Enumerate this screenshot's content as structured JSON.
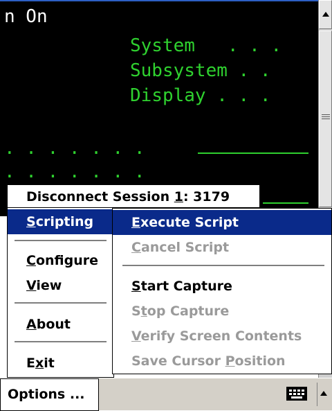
{
  "terminal": {
    "line1": "n On",
    "line2": "System   . . .",
    "line3": "Subsystem . .",
    "line4": "Display . . .",
    "dots1": ". . . . . . .",
    "dots2": ". . . . . . ."
  },
  "session_menu": {
    "label_prefix": "Disconnect Session ",
    "label_number": "1",
    "label_suffix": ": 3179"
  },
  "options_menu": {
    "items": [
      {
        "accel": "S",
        "rest": "cripting",
        "state": "selected"
      },
      {
        "accel": "C",
        "rest": "onfigure",
        "state": "enabled"
      },
      {
        "accel": "V",
        "rest": "iew",
        "state": "enabled"
      },
      {
        "accel": "A",
        "rest": "bout",
        "state": "enabled"
      },
      {
        "pre": "E",
        "accel": "x",
        "rest": "it",
        "state": "enabled"
      }
    ]
  },
  "scripting_submenu": {
    "items": [
      {
        "accel": "E",
        "rest": "xecute Script",
        "state": "selected"
      },
      {
        "accel": "C",
        "rest": "ancel Script",
        "state": "disabled"
      },
      {
        "accel": "S",
        "rest": "tart Capture",
        "state": "enabled"
      },
      {
        "pre": "S",
        "accel": "t",
        "rest": "op Capture",
        "state": "disabled"
      },
      {
        "accel": "V",
        "rest": "erify Screen Contents",
        "state": "disabled"
      },
      {
        "pre": "Save Cursor ",
        "accel": "P",
        "rest": "osition",
        "state": "disabled"
      }
    ]
  },
  "taskbar": {
    "options_button": "Options ...",
    "keyboard_icon": "keyboard-icon",
    "sip_arrow_icon": "up-arrow-icon"
  },
  "colors": {
    "terminal_bg": "#000000",
    "terminal_green": "#2fd12f",
    "selection": "#0a2a8a",
    "disabled_text": "#9a9a9a"
  }
}
